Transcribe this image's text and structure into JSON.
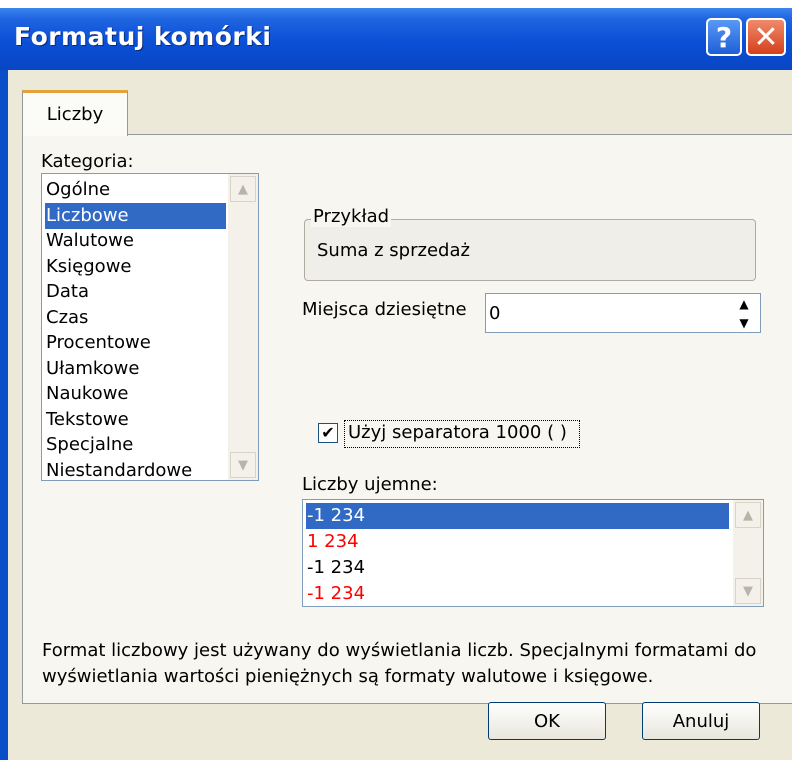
{
  "window": {
    "title": "Formatuj komórki"
  },
  "titlebar": {
    "help_glyph": "?",
    "close_glyph": "✕"
  },
  "tabs": [
    {
      "label": "Liczby"
    }
  ],
  "category": {
    "label": "Kategoria:",
    "items": [
      "Ogólne",
      "Liczbowe",
      "Walutowe",
      "Księgowe",
      "Data",
      "Czas",
      "Procentowe",
      "Ułamkowe",
      "Naukowe",
      "Tekstowe",
      "Specjalne",
      "Niestandardowe"
    ],
    "selected": "Liczbowe"
  },
  "sample": {
    "legend": "Przykład",
    "value": "Suma z sprzedaż"
  },
  "decimals": {
    "label": "Miejsca dziesiętne",
    "value": "0"
  },
  "separator": {
    "checked": true,
    "label": "Użyj separatora 1000 ( )",
    "check_glyph": "✔"
  },
  "negatives": {
    "label": "Liczby ujemne:",
    "items": [
      {
        "text": "-1 234",
        "color": "#000000"
      },
      {
        "text": "1 234",
        "color": "#ff0000"
      },
      {
        "text": "-1 234",
        "color": "#000000"
      },
      {
        "text": "-1 234",
        "color": "#ff0000"
      }
    ],
    "selected_index": 0
  },
  "description": "Format liczbowy jest używany do wyświetlania liczb. Specjalnymi formatami do wyświetlania wartości pieniężnych są formaty walutowe i księgowe.",
  "buttons": {
    "ok": "OK",
    "cancel": "Anuluj"
  },
  "colors": {
    "title_bar": "#0b4fd6",
    "dialog_face": "#ece9d8",
    "selection": "#316ac5",
    "negative_red": "#ff0000"
  },
  "icons": {
    "scroll_up": "▲",
    "scroll_down": "▼",
    "help": "help-icon",
    "close": "close-icon"
  }
}
